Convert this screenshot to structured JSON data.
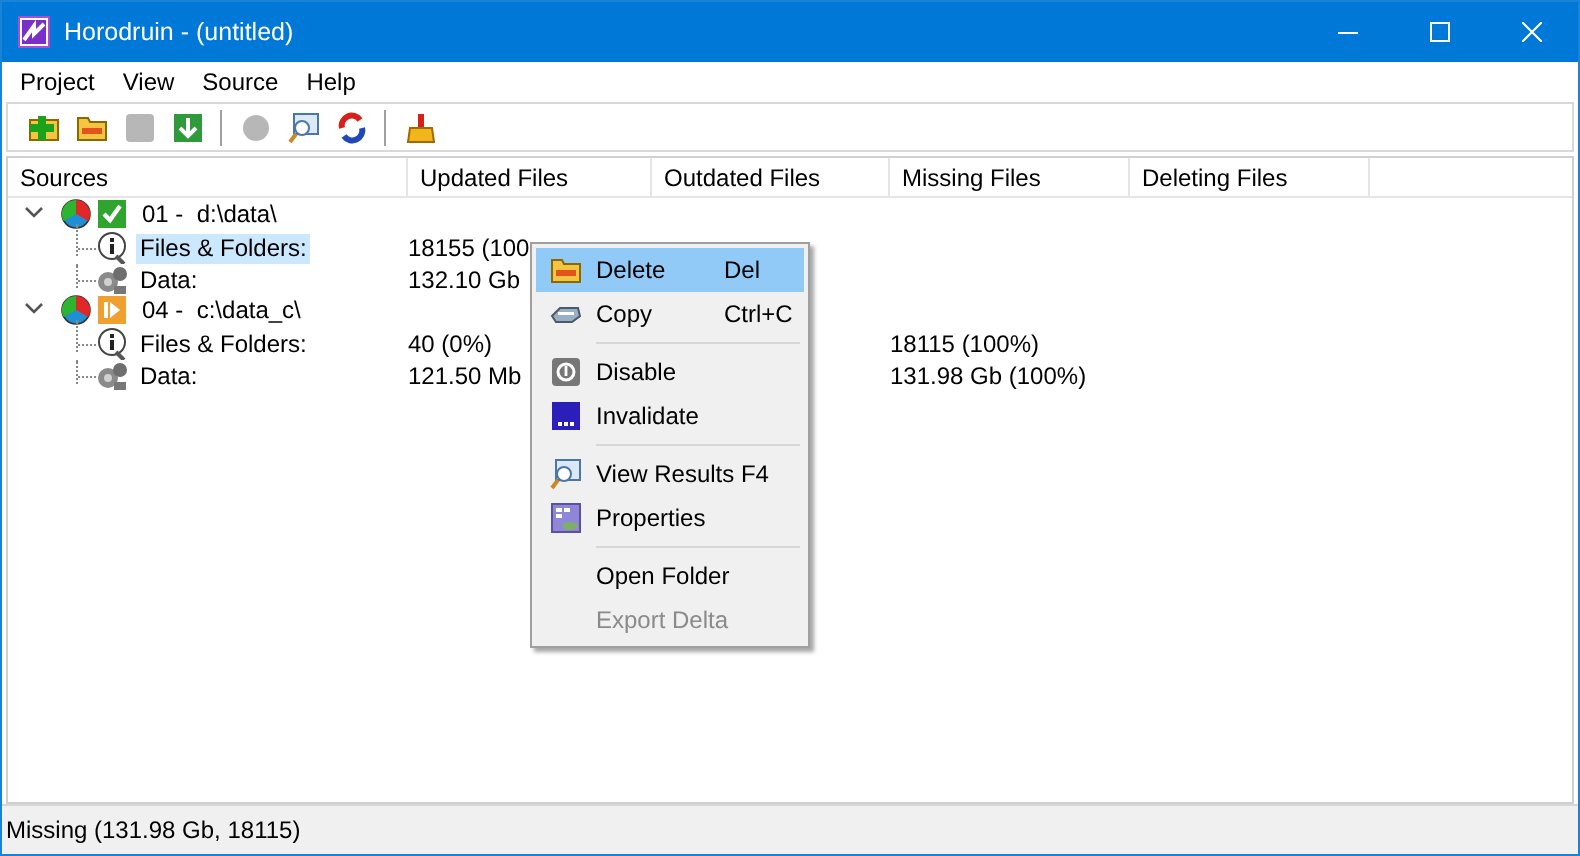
{
  "window": {
    "title": "Horodruin - (untitled)"
  },
  "menu_bar": [
    "Project",
    "View",
    "Source",
    "Help"
  ],
  "toolbar": [
    {
      "kind": "add",
      "disabled": false
    },
    {
      "kind": "open",
      "disabled": false
    },
    {
      "kind": "stop",
      "disabled": true
    },
    {
      "kind": "download",
      "disabled": false
    },
    {
      "kind": "separator"
    },
    {
      "kind": "find",
      "disabled": true
    },
    {
      "kind": "view",
      "disabled": false
    },
    {
      "kind": "refresh",
      "disabled": false
    },
    {
      "kind": "separator"
    },
    {
      "kind": "clean",
      "disabled": false
    }
  ],
  "columns": [
    "Sources",
    "Updated Files",
    "Outdated Files",
    "Missing Files",
    "Deleting Files"
  ],
  "sources": [
    {
      "label": "01 -  d:\\data\\",
      "expanded": true,
      "kind": "check",
      "children": [
        {
          "label": "Files & Folders:",
          "kind": "info",
          "selected": true,
          "updated_files": "18155 (100"
        },
        {
          "label": "Data:",
          "kind": "data",
          "selected": false,
          "updated_files": "132.10 Gb"
        }
      ]
    },
    {
      "label": "04 -  c:\\data_c\\",
      "expanded": true,
      "kind": "play",
      "children": [
        {
          "label": "Files & Folders:",
          "kind": "info",
          "selected": false,
          "updated_files": "40 (0%)",
          "missing_files": "18115 (100%)"
        },
        {
          "label": "Data:",
          "kind": "data",
          "selected": false,
          "updated_files": "121.50 Mb",
          "missing_files": "131.98 Gb (100%)"
        }
      ]
    }
  ],
  "context_menu": [
    {
      "kind": "delete",
      "label": "Delete",
      "shortcut": "Del",
      "selected": true,
      "disabled": false
    },
    {
      "kind": "copy",
      "label": "Copy",
      "shortcut": "Ctrl+C",
      "selected": false,
      "disabled": false
    },
    {
      "kind": "separator"
    },
    {
      "kind": "disable",
      "label": "Disable",
      "selected": false,
      "disabled": false
    },
    {
      "kind": "invalidate",
      "label": "Invalidate",
      "selected": false,
      "disabled": false
    },
    {
      "kind": "separator"
    },
    {
      "kind": "view",
      "label": "View Results F4",
      "selected": false,
      "disabled": false
    },
    {
      "kind": "properties",
      "label": "Properties",
      "selected": false,
      "disabled": false
    },
    {
      "kind": "separator"
    },
    {
      "kind": "plain",
      "label": "Open Folder",
      "selected": false,
      "disabled": false
    },
    {
      "kind": "plain",
      "label": "Export Delta",
      "selected": false,
      "disabled": true
    }
  ],
  "status_bar": "Missing (131.98 Gb, 18115)"
}
